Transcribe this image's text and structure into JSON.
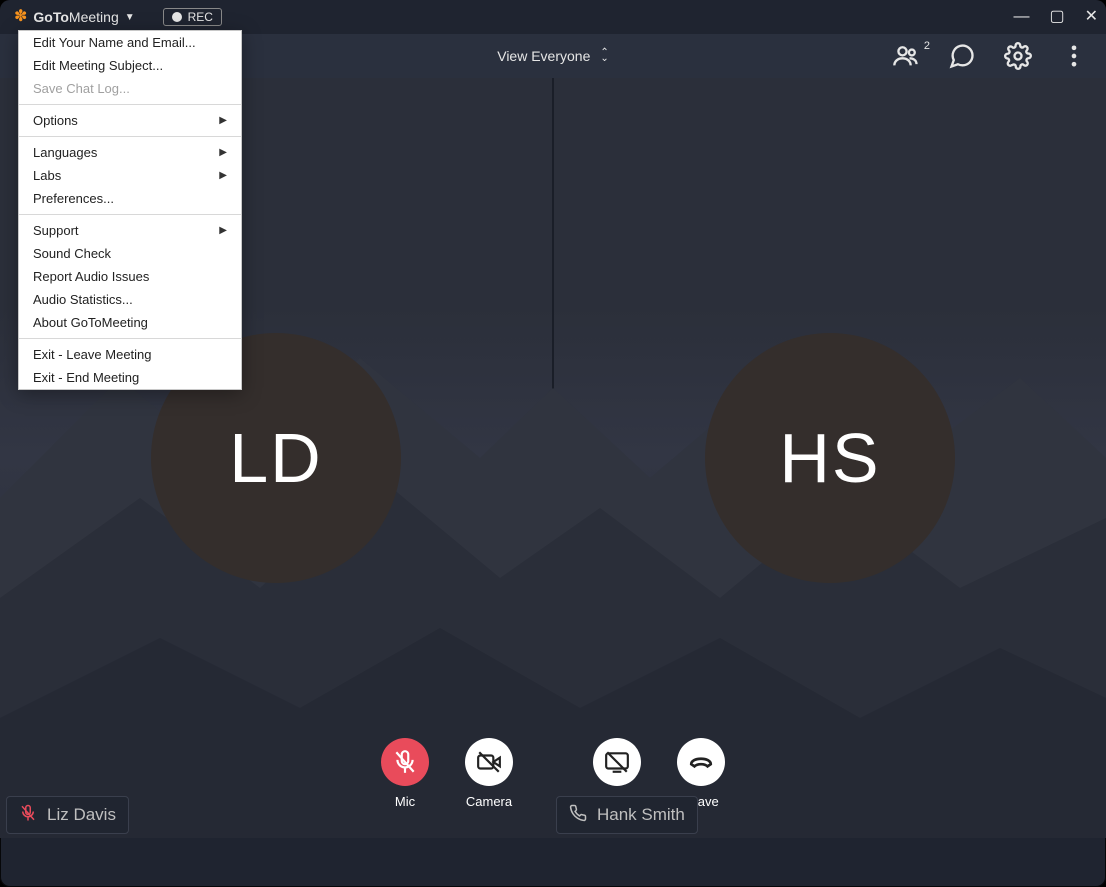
{
  "brand": {
    "prefix": "GoTo",
    "suffix": "Meeting"
  },
  "rec_label": "REC",
  "toolbar": {
    "view_label": "View Everyone",
    "people_count": "2"
  },
  "menu": {
    "edit_name": "Edit Your Name and Email...",
    "edit_subject": "Edit Meeting Subject...",
    "save_chat": "Save Chat Log...",
    "options": "Options",
    "languages": "Languages",
    "labs": "Labs",
    "preferences": "Preferences...",
    "support": "Support",
    "sound_check": "Sound Check",
    "report_audio": "Report Audio Issues",
    "audio_stats": "Audio Statistics...",
    "about": "About GoToMeeting",
    "exit_leave": "Exit - Leave Meeting",
    "exit_end": "Exit - End Meeting"
  },
  "participants": [
    {
      "initials": "LD",
      "name": "Liz Davis",
      "muted": true
    },
    {
      "initials": "HS",
      "name": "Hank Smith",
      "muted": false
    }
  ],
  "controls": {
    "mic": "Mic",
    "camera": "Camera",
    "screen": "Screen",
    "leave": "Leave"
  }
}
